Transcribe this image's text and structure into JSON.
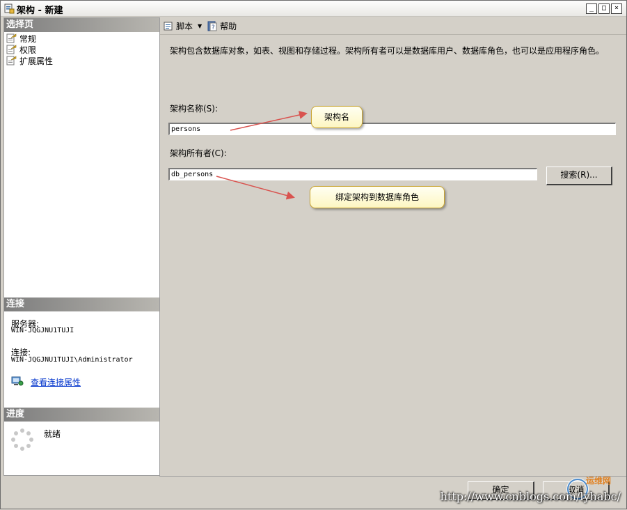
{
  "window": {
    "title": "架构 - 新建",
    "buttons": [
      "_",
      "□",
      "×"
    ]
  },
  "left": {
    "select_page_header": "选择页",
    "nav_items": [
      {
        "label": "常规",
        "icon": "page-icon",
        "selected": true
      },
      {
        "label": "权限",
        "icon": "page-icon",
        "selected": false
      },
      {
        "label": "扩展属性",
        "icon": "page-icon",
        "selected": false
      }
    ],
    "connection_header": "连接",
    "server_label": "服务器:",
    "server_value": "WIN-JQGJNU1TUJI",
    "connection_label": "连接:",
    "connection_value": "WIN-JQGJNU1TUJI\\Administrator",
    "view_conn_link": "查看连接属性",
    "progress_header": "进度",
    "progress_status": "就绪"
  },
  "toolbar": {
    "script_label": "脚本",
    "help_label": "帮助"
  },
  "main": {
    "description": "架构包含数据库对象，如表、视图和存储过程。架构所有者可以是数据库用户、数据库角色，也可以是应用程序角色。",
    "schema_name_label": "架构名称(S):",
    "schema_name_value": "persons",
    "schema_owner_label": "架构所有者(C):",
    "schema_owner_value": "db_persons",
    "search_button": "搜索(R)..."
  },
  "callouts": {
    "name_note": "架构名",
    "owner_note": "绑定架构到数据库角色"
  },
  "footer": {
    "ok_button": "确定",
    "cancel_button": "取消"
  },
  "watermark": {
    "url": "http://www.cnblogs.com/lyhabc/",
    "logo_text": "运维网"
  },
  "colors": {
    "window_bg": "#d4d0c8",
    "header_gradient_start": "#7d7d7d",
    "link": "#0033cc",
    "callout_fill": "#fdf6c2",
    "callout_border": "#c9a430",
    "arrow": "#d9534f"
  }
}
